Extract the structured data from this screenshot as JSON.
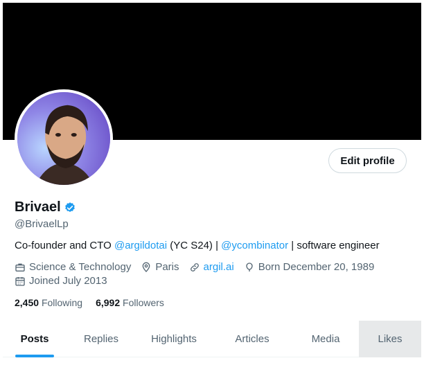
{
  "profile": {
    "display_name": "Brivael",
    "handle": "@BrivaelLp",
    "edit_button": "Edit profile"
  },
  "bio": {
    "part1": "Co-founder and CTO ",
    "mention1": "@argildotai",
    "part2": " (YC S24) | ",
    "mention2": "@ycombinator",
    "part3": " | software engineer"
  },
  "meta": {
    "category": "Science & Technology",
    "location": "Paris",
    "website": "argil.ai",
    "birthday": "Born December 20, 1989",
    "joined": "Joined July 2013"
  },
  "stats": {
    "following_count": "2,450",
    "following_label": "Following",
    "followers_count": "6,992",
    "followers_label": "Followers"
  },
  "tabs": [
    {
      "label": "Posts"
    },
    {
      "label": "Replies"
    },
    {
      "label": "Highlights"
    },
    {
      "label": "Articles"
    },
    {
      "label": "Media"
    },
    {
      "label": "Likes"
    }
  ],
  "colors": {
    "accent": "#1d9bf0",
    "text": "#0f1419",
    "muted": "#536471",
    "banner": "#000000"
  },
  "icons": {
    "verified": "verified-badge-icon",
    "category": "briefcase-icon",
    "location": "location-pin-icon",
    "website": "link-icon",
    "birthday": "balloon-icon",
    "joined": "calendar-icon"
  }
}
